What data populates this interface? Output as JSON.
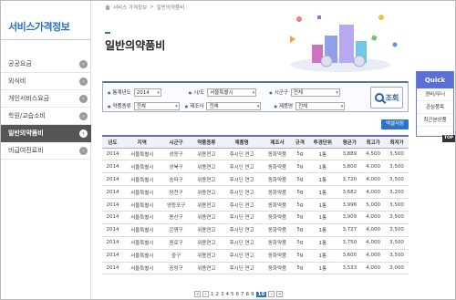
{
  "sidebar": {
    "brand": "서비스가격정보",
    "items": [
      {
        "label": "공공요금",
        "active": false
      },
      {
        "label": "외식비",
        "active": false
      },
      {
        "label": "개인서비스요금",
        "active": false
      },
      {
        "label": "학원/교습소비",
        "active": false
      },
      {
        "label": "일반의약품비",
        "active": true
      },
      {
        "label": "비급여진료비",
        "active": false
      }
    ]
  },
  "breadcrumb": [
    "서비스 가격정보",
    ">",
    "일반의약품비"
  ],
  "page_title": "일반의약품비",
  "search": {
    "year_label": "통계년도",
    "year_value": "2014",
    "sido_label": "시/도",
    "sido_value": "서울특별시",
    "sigungu_label": "시군구",
    "sigungu_value": "전체",
    "drugtype_label": "약품종류",
    "drugtype_value": "전체",
    "maker_label": "제조사",
    "maker_value": "전체",
    "product_label": "제품명",
    "product_value": "전체",
    "button_label": "조회"
  },
  "download_label": "엑셀저장",
  "table": {
    "headers": [
      "년도",
      "지역",
      "시군구",
      "약품종류",
      "제품명",
      "제조사",
      "규격",
      "투경단위",
      "평균가",
      "최고가",
      "최저가"
    ],
    "rows": [
      [
        "2014",
        "서울특별시",
        "성동구",
        "위용연고",
        "후시딘 연고",
        "동화약품",
        "5g",
        "1통",
        "3,889",
        "4,500",
        "3,500"
      ],
      [
        "2014",
        "서울특별시",
        "성북구",
        "위용연고",
        "후시딘 연고",
        "동화약품",
        "5g",
        "1통",
        "3,800",
        "4,000",
        "3,500"
      ],
      [
        "2014",
        "서울특별시",
        "송파구",
        "위용연고",
        "후시딘 연고",
        "동화약품",
        "5g",
        "1통",
        "3,720",
        "4,000",
        "3,500"
      ],
      [
        "2014",
        "서울특별시",
        "양천구",
        "위용연고",
        "후시딘 연고",
        "동화약품",
        "5g",
        "1통",
        "3,682",
        "4,000",
        "3,200"
      ],
      [
        "2014",
        "서울특별시",
        "영등포구",
        "위용연고",
        "후시딘 연고",
        "동화약품",
        "5g",
        "1통",
        "3,996",
        "5,000",
        "3,500"
      ],
      [
        "2014",
        "서울특별시",
        "용산구",
        "위용연고",
        "후시딘 연고",
        "동화약품",
        "5g",
        "1통",
        "3,909",
        "4,000",
        "3,500"
      ],
      [
        "2014",
        "서울특별시",
        "은평구",
        "위용연고",
        "후시딘 연고",
        "동화약품",
        "5g",
        "1통",
        "3,727",
        "4,000",
        "3,500"
      ],
      [
        "2014",
        "서울특별시",
        "종로구",
        "위용연고",
        "후시딘 연고",
        "동화약품",
        "5g",
        "1통",
        "3,750",
        "4,000",
        "3,500"
      ],
      [
        "2014",
        "서울특별시",
        "중구",
        "위용연고",
        "후시딘 연고",
        "동화약품",
        "5g",
        "1통",
        "3,600",
        "4,000",
        "3,500"
      ],
      [
        "2014",
        "서울특별시",
        "중랑구",
        "위용연고",
        "후시딘 연고",
        "동화약품",
        "5g",
        "1통",
        "3,533",
        "4,000",
        "3,000"
      ]
    ]
  },
  "pagination": {
    "prev_first": "«",
    "prev": "‹",
    "pages": [
      "1",
      "2",
      "3",
      "4",
      "5",
      "6",
      "7",
      "8",
      "9"
    ],
    "current": "10",
    "next": "›",
    "next_last": "»"
  },
  "quick": {
    "title": "Quick",
    "items": [
      "경비/무너",
      "관심품목",
      "최근본상품"
    ],
    "top_label": "TOP"
  }
}
